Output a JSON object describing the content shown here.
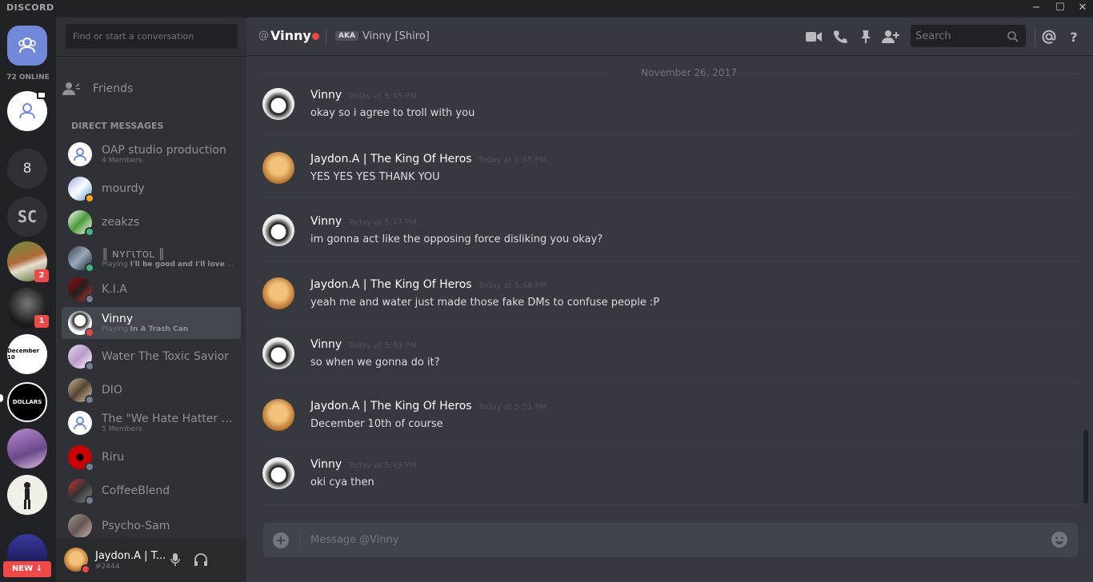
{
  "app": {
    "logo": "DISCORD",
    "window_controls": [
      "−",
      "☐",
      "✕"
    ]
  },
  "guilds": {
    "online_count": "72 ONLINE",
    "icons": [
      "home-icon",
      "group-dm-icon",
      "server-8",
      "server-sc",
      "server-cow",
      "server-2",
      "server-december-10",
      "server-dollars",
      "server-anime",
      "server-person",
      "server-blue"
    ],
    "server_8_label": "8",
    "server_sc_label": "SC",
    "server_dec_label": "December 10",
    "server_dollars_label": "DOLLARS",
    "badge_cow": "2",
    "badge_2": "1",
    "new_label": "NEW ↓"
  },
  "dm_panel": {
    "search_placeholder": "Find or start a conversation",
    "friends_label": "Friends",
    "section_header": "DIRECT MESSAGES",
    "items": [
      {
        "name": "OAP studio production",
        "sub": "4 Members"
      },
      {
        "name": "mourdy",
        "sub": ""
      },
      {
        "name": "zeakzs",
        "sub": ""
      },
      {
        "name": "║ ɴʏгιтoʟ ║",
        "sub_prefix": "Playing ",
        "sub": "I'll be good and I'll love the w..."
      },
      {
        "name": "K.I.A",
        "sub": ""
      },
      {
        "name": "Vinny",
        "sub_prefix": "Playing ",
        "sub": "In A Trash Can"
      },
      {
        "name": "Water The Toxic Savior",
        "sub": ""
      },
      {
        "name": "DIO",
        "sub": ""
      },
      {
        "name": "The \"We Hate Hatter G...",
        "sub": "5 Members"
      },
      {
        "name": "Riru",
        "sub": ""
      },
      {
        "name": "CoffeeBlend",
        "sub": ""
      },
      {
        "name": "Psycho-Sam",
        "sub": ""
      }
    ],
    "user": {
      "name": "Jaydon.A | T...",
      "tag": "#2444"
    }
  },
  "chat": {
    "at": "@",
    "channel_name": "Vinny",
    "aka_badge": "AKA",
    "aka_name": "Vinny [Shiro]",
    "search_placeholder": "Search",
    "date_divider": "November 26, 2017",
    "messages": [
      {
        "author": "Vinny",
        "time": "Today at 5:45 PM",
        "text": "okay so i agree to troll with you"
      },
      {
        "author": "Jaydon.A | The King Of Heros",
        "time": "Today at 5:45 PM",
        "text": "YES YES YES THANK YOU"
      },
      {
        "author": "Vinny",
        "time": "Today at 5:47 PM",
        "text": "im gonna act like the opposing force disliking you okay?"
      },
      {
        "author": "Jaydon.A | The King Of Heros",
        "time": "Today at 5:48 PM",
        "text": "yeah me and water just made those fake DMs to confuse people :P"
      },
      {
        "author": "Vinny",
        "time": "Today at 5:49 PM",
        "text": "so when we gonna do it?"
      },
      {
        "author": "Jaydon.A | The King Of Heros",
        "time": "Today at 5:51 PM",
        "text": "December 10th of course"
      },
      {
        "author": "Vinny",
        "time": "Today at 5:49 PM",
        "text": "oki cya then"
      }
    ],
    "composer_placeholder": "Message @Vinny"
  },
  "colors": {
    "online": "#43b581",
    "idle": "#faa61a",
    "dnd": "#f04747",
    "offline": "#747f8d",
    "blurple": "#7289da"
  }
}
